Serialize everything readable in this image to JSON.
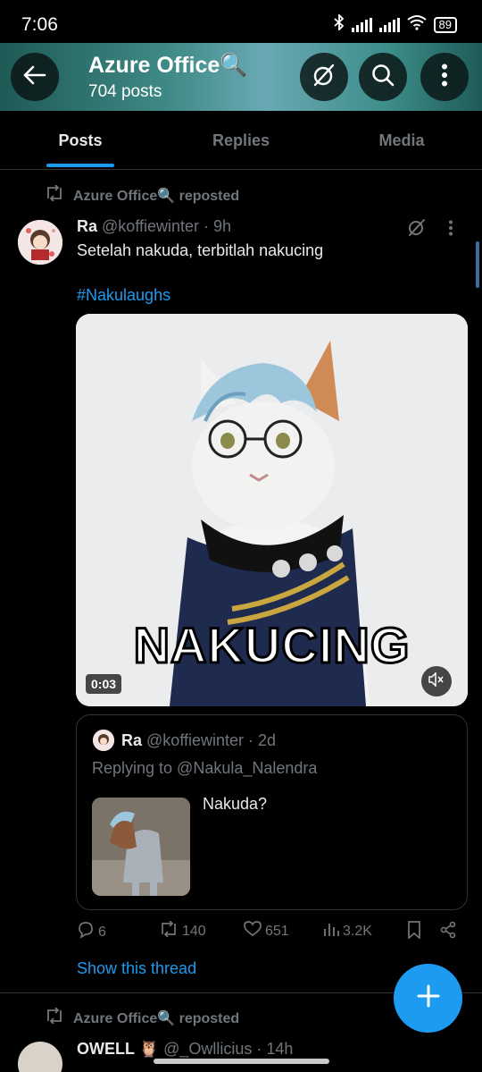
{
  "status_bar": {
    "time": "7:06",
    "battery": "89"
  },
  "header": {
    "title": "Azure Office🔍",
    "post_count": "704 posts"
  },
  "tabs": [
    {
      "label": "Posts",
      "active": true
    },
    {
      "label": "Replies",
      "active": false
    },
    {
      "label": "Media",
      "active": false
    }
  ],
  "post": {
    "repost_label": "Azure Office🔍 reposted",
    "name": "Ra",
    "handle": "@koffiewinter",
    "time": "· 9h",
    "text": "Setelah nakuda, terbitlah nakucing",
    "hashtag": "#Nakulaughs",
    "media": {
      "caption": "NAKUCING",
      "duration": "0:03"
    },
    "quote": {
      "name": "Ra",
      "handle": "@koffiewinter",
      "time": "· 2d",
      "replying": "Replying to @Nakula_Nalendra",
      "text": "Nakuda?"
    },
    "actions": {
      "replies": "6",
      "reposts": "140",
      "likes": "651",
      "views": "3.2K"
    },
    "show_thread": "Show this thread"
  },
  "post2": {
    "repost_label": "Azure Office🔍 reposted",
    "name": "OWELL 🦉",
    "handle": "@_Owllicius",
    "time": "· 14h"
  },
  "colors": {
    "accent": "#1d9bf0",
    "muted": "#71767b",
    "text": "#e7e9ea",
    "background": "#000000"
  }
}
